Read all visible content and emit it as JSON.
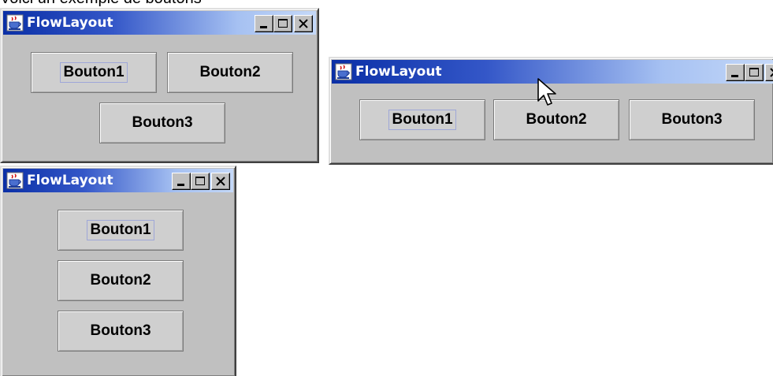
{
  "caption": "Voici un exemple de boutons",
  "windows": [
    {
      "title": "FlowLayout",
      "buttons": [
        "Bouton1",
        "Bouton2",
        "Bouton3"
      ]
    },
    {
      "title": "FlowLayout",
      "buttons": [
        "Bouton1",
        "Bouton2",
        "Bouton3"
      ]
    },
    {
      "title": "FlowLayout",
      "buttons": [
        "Bouton1",
        "Bouton2",
        "Bouton3"
      ]
    }
  ],
  "icons": {
    "app": "java-cup-icon",
    "minimize": "minimize-icon",
    "maximize": "maximize-icon",
    "close": "close-icon",
    "cursor": "mouse-pointer-icon"
  },
  "colors": {
    "titlebar_start": "#0a2fa6",
    "titlebar_end": "#c4d8f8",
    "window_bg": "#c0c0c0",
    "focus_outline": "#9ea7d8"
  }
}
